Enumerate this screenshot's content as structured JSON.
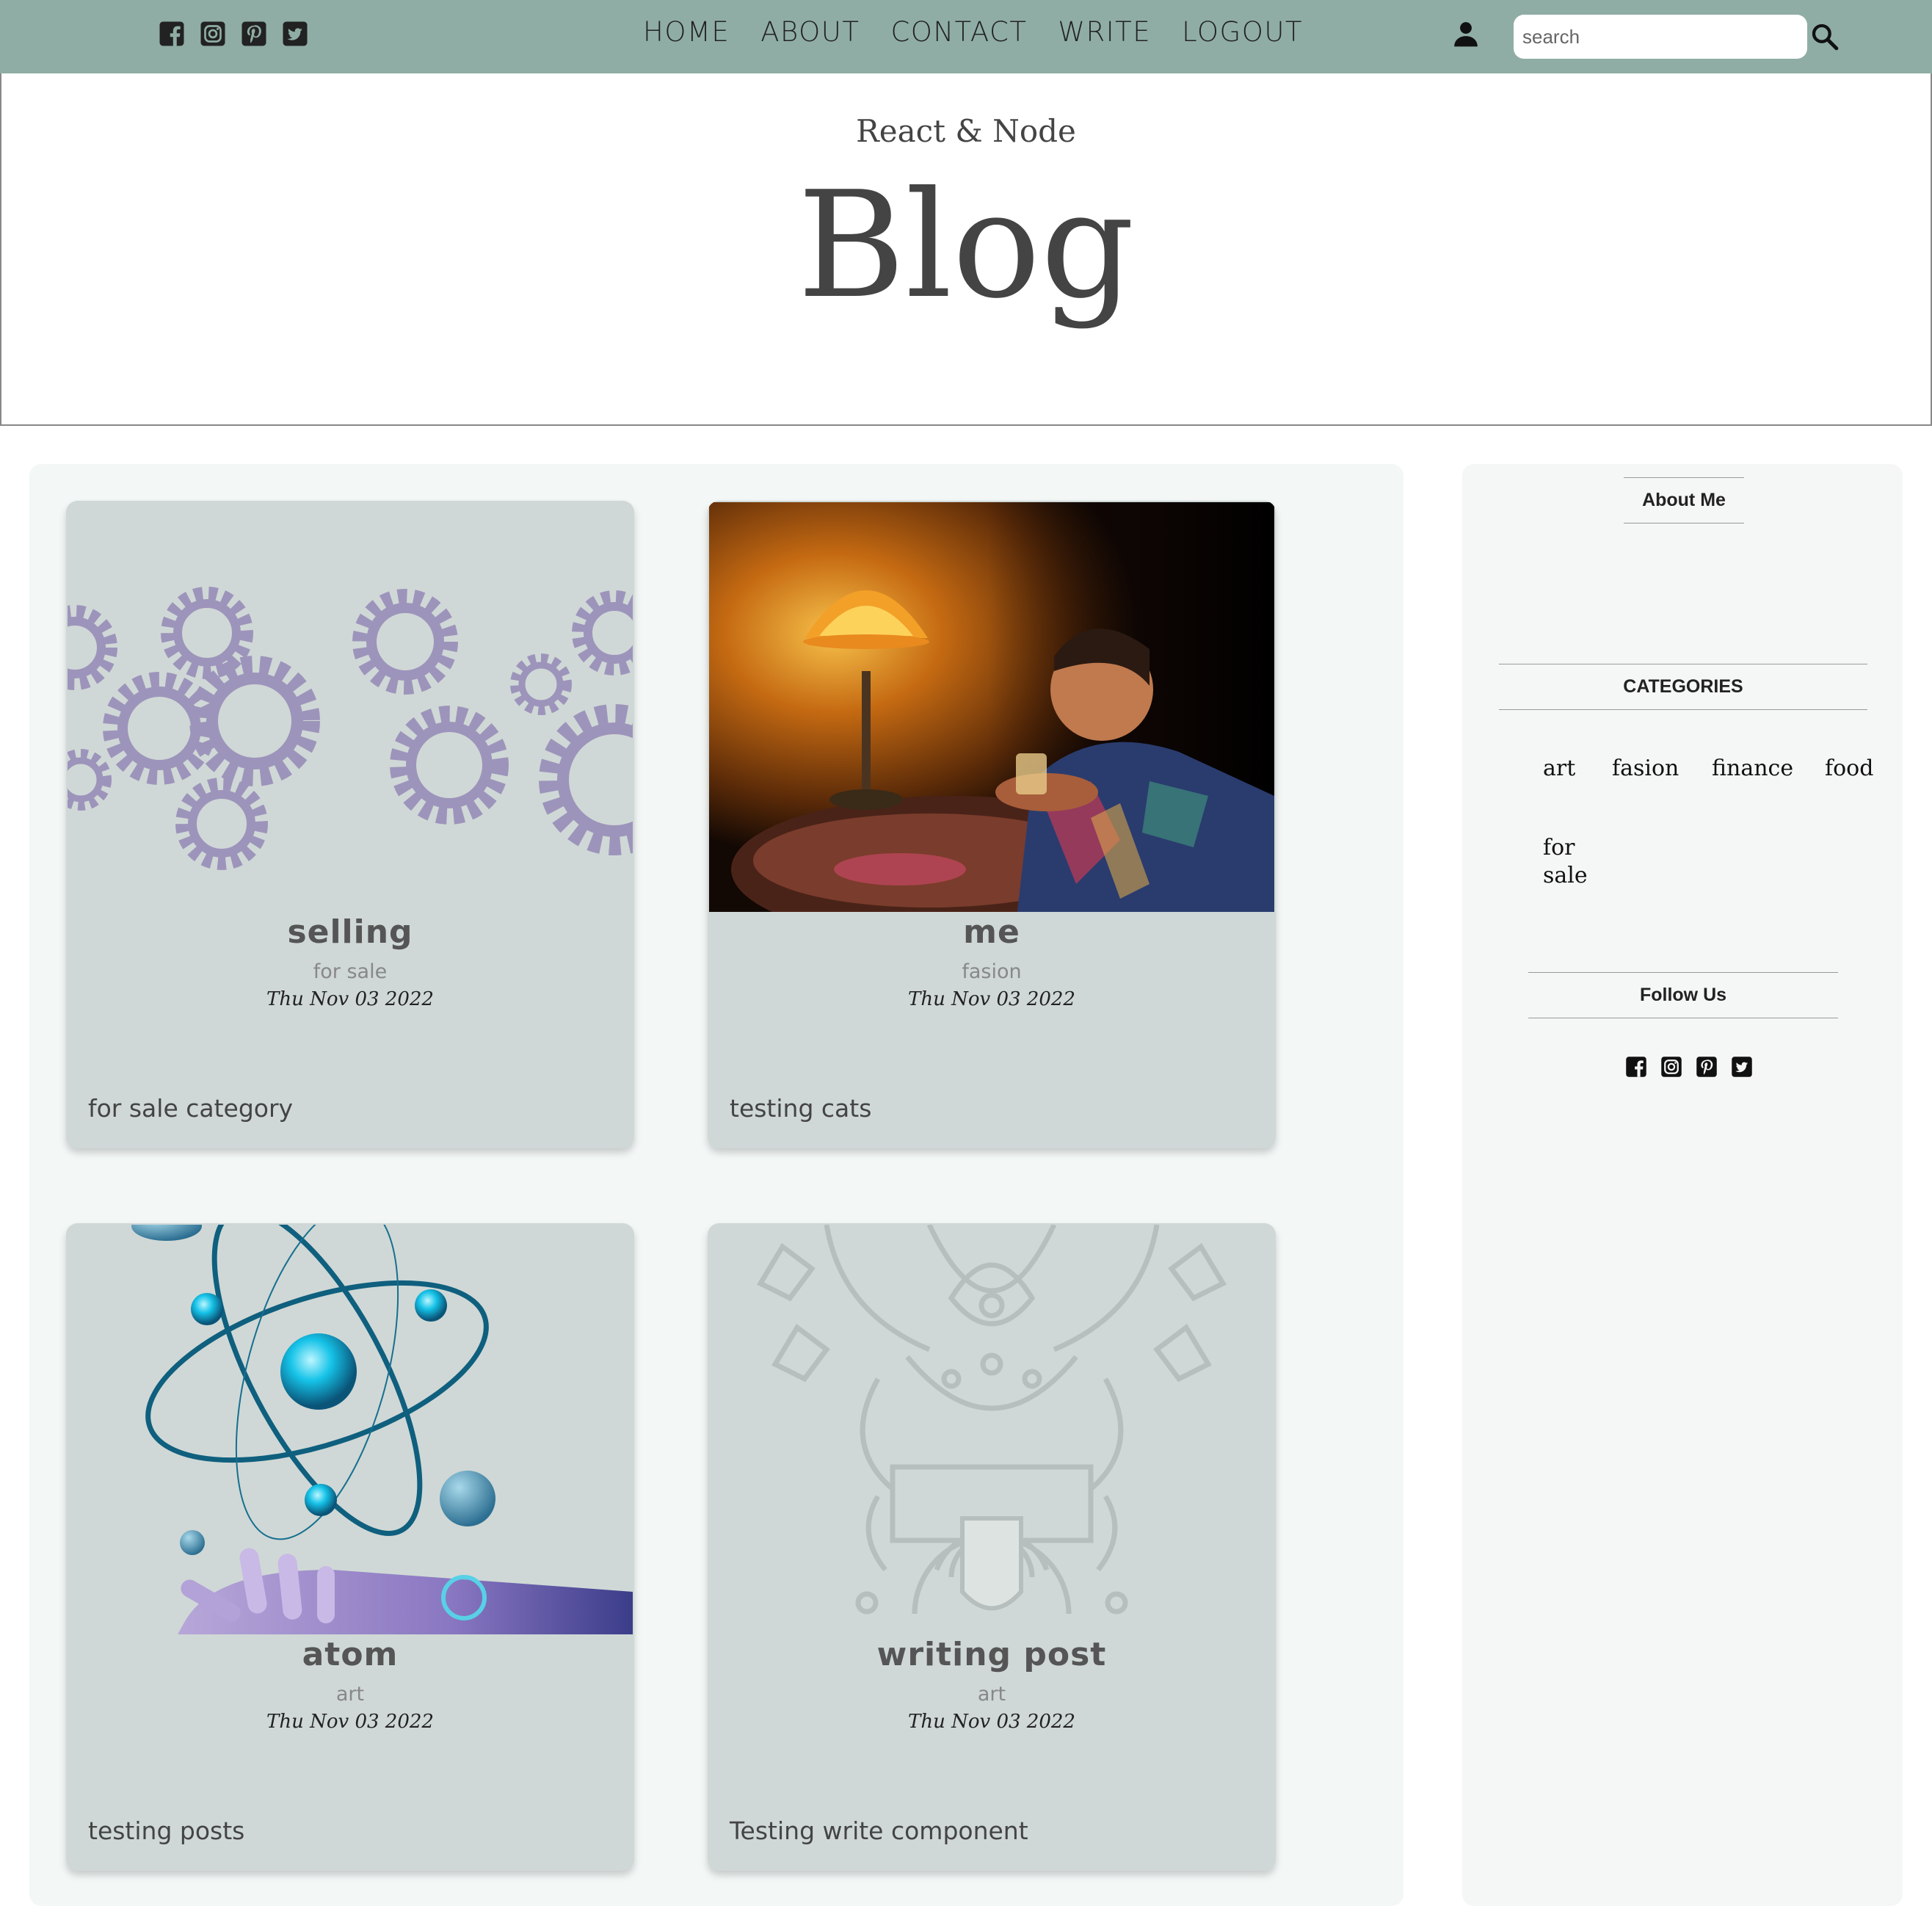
{
  "topbar": {
    "social_icons": [
      "facebook-icon",
      "instagram-icon",
      "pinterest-icon",
      "twitter-icon"
    ],
    "nav": [
      "HOME",
      "ABOUT",
      "CONTACT",
      "WRITE",
      "LOGOUT"
    ],
    "search_placeholder": "search",
    "background": "#8fada4"
  },
  "header": {
    "subtitle": "React & Node",
    "title": "Blog"
  },
  "posts": [
    {
      "title": "selling",
      "category": "for sale",
      "date": "Thu Nov 03 2022",
      "description": "for sale category",
      "image": "gears"
    },
    {
      "title": "me",
      "category": "fasion",
      "date": "Thu Nov 03 2022",
      "description": "testing cats",
      "image": "man-with-lamp-photo"
    },
    {
      "title": "atom",
      "category": "art",
      "date": "Thu Nov 03 2022",
      "description": "testing posts",
      "image": "atom-and-robot-hand"
    },
    {
      "title": "writing post",
      "category": "art",
      "date": "Thu Nov 03 2022",
      "description": "Testing write component",
      "image": "line-art-mascot"
    }
  ],
  "sidebar": {
    "about_title": "About Me",
    "categories_title": "CATEGORIES",
    "categories": [
      "art",
      "fasion",
      "finance",
      "food",
      "for sale"
    ],
    "follow_title": "Follow Us"
  },
  "colors": {
    "card_bg": "#cfd8d6",
    "posts_bg": "#f3f7f6",
    "gear_purple": "#9d94bb"
  }
}
